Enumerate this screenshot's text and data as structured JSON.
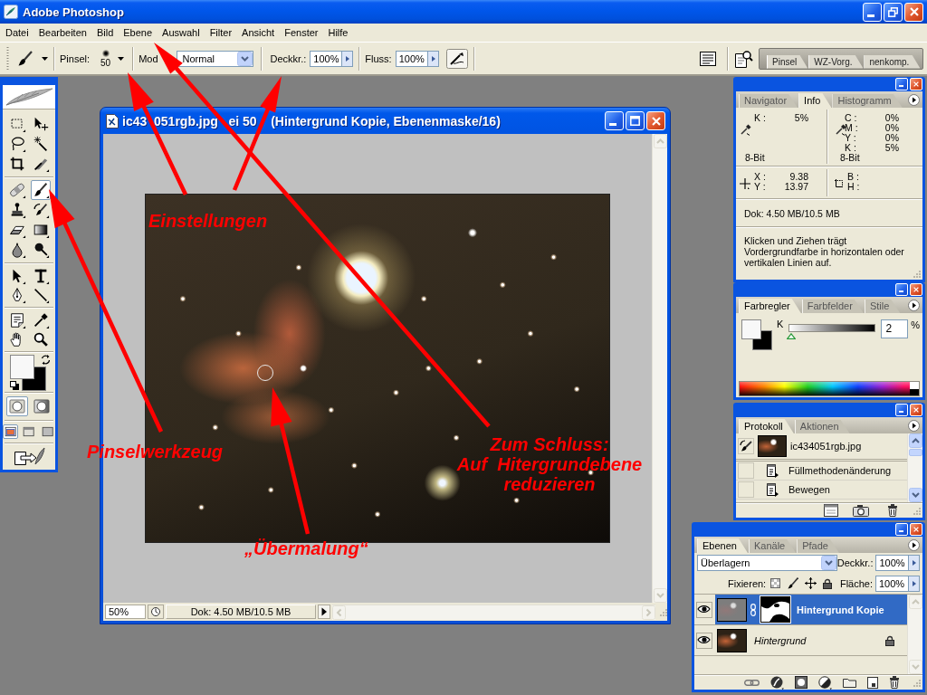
{
  "app": {
    "title": "Adobe Photoshop"
  },
  "menu_bar": [
    {
      "label": "Datei"
    },
    {
      "label": "Bearbeiten"
    },
    {
      "label": "Bild"
    },
    {
      "label": "Ebene"
    },
    {
      "label": "Auswahl"
    },
    {
      "label": "Filter"
    },
    {
      "label": "Ansicht"
    },
    {
      "label": "Fenster"
    },
    {
      "label": "Hilfe"
    }
  ],
  "options_bar": {
    "brush_label": "Pinsel:",
    "brush_size": "50",
    "mode_label": "Mod",
    "mode": "Normal",
    "opacity_label": "Deckkr.:",
    "opacity": "100%",
    "flow_label": "Fluss:",
    "flow": "100%",
    "palette_well_tabs": [
      {
        "label": "Pinsel"
      },
      {
        "label": "WZ-Vorg."
      },
      {
        "label": "nenkomp."
      }
    ]
  },
  "toolbox": {
    "tool_groups": [
      {
        "tools": [
          {
            "kind": "marquee",
            "selected": false
          },
          {
            "kind": "move",
            "selected": false
          },
          {
            "kind": "lasso",
            "selected": false
          },
          {
            "kind": "magic_wand",
            "selected": false
          },
          {
            "kind": "crop",
            "selected": false
          },
          {
            "kind": "slice",
            "selected": false
          }
        ]
      },
      {
        "tools": [
          {
            "kind": "healing_brush",
            "selected": false
          },
          {
            "kind": "brush",
            "selected": true
          },
          {
            "kind": "clone_stamp",
            "selected": false
          },
          {
            "kind": "history_brush",
            "selected": false
          },
          {
            "kind": "eraser",
            "selected": false
          },
          {
            "kind": "gradient",
            "selected": false
          },
          {
            "kind": "blur",
            "selected": false
          },
          {
            "kind": "dodge",
            "selected": false
          }
        ]
      },
      {
        "tools": [
          {
            "kind": "path_selection",
            "selected": false
          },
          {
            "kind": "type",
            "selected": false
          },
          {
            "kind": "pen",
            "selected": false
          },
          {
            "kind": "line",
            "selected": false
          }
        ]
      },
      {
        "tools": [
          {
            "kind": "notes",
            "selected": false
          },
          {
            "kind": "eyedropper",
            "selected": false
          },
          {
            "kind": "hand",
            "selected": false
          },
          {
            "kind": "zoom",
            "selected": false
          }
        ]
      }
    ],
    "swatches": [
      {
        "kind": "foreground",
        "color": "#f8f8f8"
      },
      {
        "kind": "background",
        "color": "#000000"
      }
    ],
    "edit_modes": [
      {
        "kind": "standard",
        "selected": true
      },
      {
        "kind": "quick_mask",
        "selected": false
      }
    ],
    "screen_modes": [
      {
        "kind": "standard",
        "selected": true
      },
      {
        "kind": "full_with_menu",
        "selected": false
      },
      {
        "kind": "full",
        "selected": false
      }
    ]
  },
  "document": {
    "title": "ic43  051rgb.jpg   ei 50    (Hintergrund Kopie, Ebenenmaske/16)",
    "zoom": "50%",
    "status": "Dok: 4.50 MB/10.5 MB"
  },
  "info_palette": {
    "tabs": [
      {
        "label": "Navigator",
        "selected": false
      },
      {
        "label": "Info",
        "selected": true
      },
      {
        "label": "Histogramm",
        "selected": false
      }
    ],
    "color_readouts": [
      {
        "rows": [
          {
            "label": "K :",
            "value": "5%"
          }
        ],
        "depth": "8-Bit"
      },
      {
        "rows": [
          {
            "label": "C :",
            "value": "0%"
          },
          {
            "label": "M :",
            "value": "0%"
          },
          {
            "label": "Y :",
            "value": "0%"
          },
          {
            "label": "K :",
            "value": "5%"
          }
        ],
        "depth": "8-Bit"
      }
    ],
    "position": [
      {
        "label": "X :",
        "value": "9.38"
      },
      {
        "label": "Y :",
        "value": "13.97"
      }
    ],
    "size": [
      {
        "label": "B :"
      },
      {
        "label": "H :"
      }
    ],
    "document_size": "Dok: 4.50 MB/10.5 MB",
    "hint": "Klicken und Ziehen trägt Vordergrundfarbe in horizontalen oder vertikalen Linien auf."
  },
  "color_palette": {
    "tabs": [
      {
        "label": "Farbregler",
        "selected": true
      },
      {
        "label": "Farbfelder",
        "selected": false
      },
      {
        "label": "Stile",
        "selected": false
      }
    ],
    "swatches": [
      {
        "kind": "foreground",
        "color": "#f8f8f8"
      },
      {
        "kind": "background",
        "color": "#000000"
      }
    ],
    "channel": {
      "label": "K",
      "level": 0.02,
      "value": "2",
      "unit": "%"
    }
  },
  "history_palette": {
    "tabs": [
      {
        "label": "Protokoll",
        "selected": true
      },
      {
        "label": "Aktionen",
        "selected": false
      }
    ],
    "snapshot": {
      "label": "ic434051rgb.jpg",
      "source": true
    },
    "states": [
      {
        "label": "Füllmethodenänderung",
        "source": false
      },
      {
        "label": "Bewegen",
        "source": false
      }
    ]
  },
  "layers_palette": {
    "tabs": [
      {
        "label": "Ebenen",
        "selected": true
      },
      {
        "label": "Kanäle",
        "selected": false
      },
      {
        "label": "Pfade",
        "selected": false
      }
    ],
    "blend_mode": "Überlagern",
    "opacity_label": "Deckkr.:",
    "opacity": "100%",
    "lock_label": "Fixieren:",
    "fill_label": "Fläche:",
    "fill": "100%",
    "layers": [
      {
        "name": "Hintergrund Kopie",
        "kind": "layer",
        "selected": true,
        "visible": true,
        "has_mask": true,
        "locked": false
      },
      {
        "name": "Hintergrund",
        "kind": "background",
        "selected": false,
        "visible": true,
        "has_mask": false,
        "locked": true
      }
    ]
  },
  "annotations": [
    {
      "text": "Einstellungen"
    },
    {
      "text": "Pinselwerkzeug"
    },
    {
      "text": "Zum Schluss:\nAuf  Hitergrundebene\nreduzieren"
    },
    {
      "text": "„Übermalung“"
    }
  ]
}
